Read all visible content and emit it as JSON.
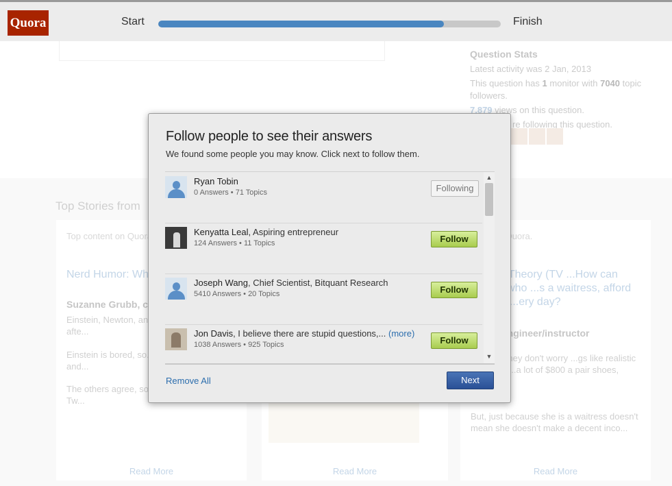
{
  "header": {
    "logo_text": "Quora",
    "progress_start_label": "Start",
    "progress_finish_label": "Finish",
    "progress_fraction": 0.834
  },
  "background": {
    "stats": {
      "title": "Question Stats",
      "latest_activity": "Latest activity was 2 Jan, 2013",
      "monitors_prefix": "This question has",
      "monitors_count": "1",
      "monitors_mid": "monitor with",
      "topic_followers": "7040",
      "monitors_suffix": "topic followers.",
      "views_count": "7,879",
      "views_suffix": "views on this question.",
      "following_fragment": "re following this question."
    },
    "stories_title": "Top Stories from",
    "cards": [
      {
        "source": "Top content on Quora",
        "title": "Nerd Humor: Wh... joke?",
        "author": "Suzanne Grubb, c",
        "para1": "Einstein, Newton, an... hanging out one afte...",
        "para2": "Einstein is bored, so... \"Let's play hide-and...",
        "para3": "The others agree, so... counting. \"One... Tw...",
        "read_more": "Read More"
      },
      {
        "read_more": "Read More"
      },
      {
        "source": "...ent on Quora.",
        "title": "...Bang Theory (TV ...How can Penny, who ...s a waitress, afford to drink ...ery day?",
        "author": "...rost, engineer/instructor",
        "para1": "...TV, so they don't worry ...gs like realistic finances. ...a lot of $800 a pair shoes,",
        "para2": "But, just because she is a waitress doesn't mean she doesn't make a decent inco...",
        "read_more": "Read More"
      }
    ]
  },
  "modal": {
    "title": "Follow people to see their answers",
    "subtitle": "We found some people you may know. Click next to follow them.",
    "people": [
      {
        "name": "Ryan Tobin",
        "credential": "",
        "meta": "0 Answers • 71 Topics",
        "button": "Following"
      },
      {
        "name": "Kenyatta Leal",
        "credential": ", Aspiring entrepreneur",
        "meta": "124 Answers • 11 Topics",
        "button": "Follow"
      },
      {
        "name": "Joseph Wang",
        "credential": ", Chief Scientist, Bitquant Research",
        "meta": "5410 Answers • 20 Topics",
        "button": "Follow"
      },
      {
        "name": "Jon Davis",
        "credential": ", I believe there are stupid questions,...",
        "more": "(more)",
        "meta": "1038 Answers • 925 Topics",
        "button": "Follow"
      }
    ],
    "remove_all": "Remove All",
    "next": "Next"
  },
  "colors": {
    "brand": "#a82400",
    "progress": "#4a86c0",
    "follow_button": "#a8cc4e",
    "next_button": "#2a5096",
    "link": "#2b6dad"
  },
  "icons": {
    "scroll_up": "▲",
    "scroll_down": "▼"
  }
}
